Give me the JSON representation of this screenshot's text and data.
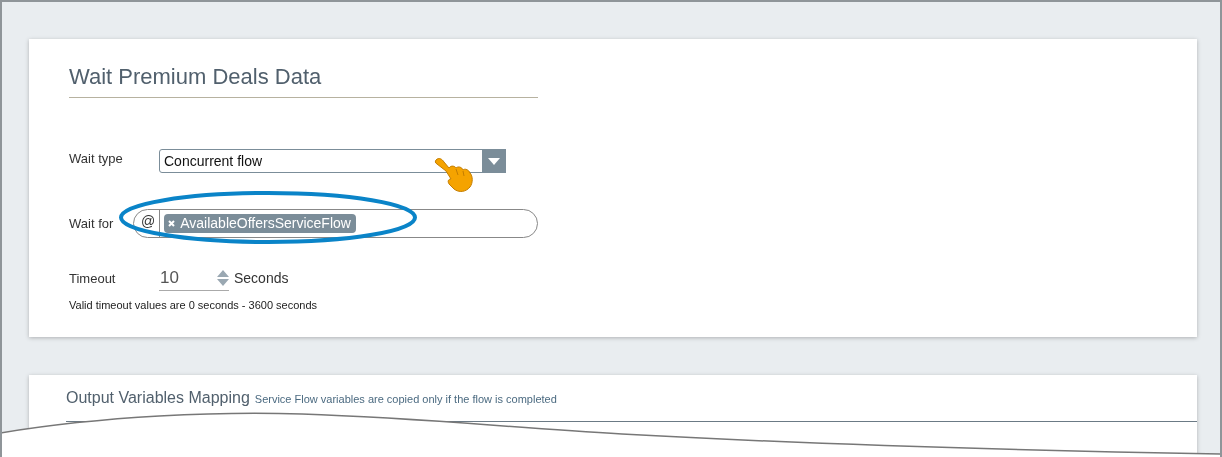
{
  "wait_card": {
    "title": "Wait Premium Deals Data",
    "wait_type": {
      "label": "Wait type",
      "value": "Concurrent flow"
    },
    "wait_for": {
      "label": "Wait for",
      "prefix": "@",
      "tokens": [
        {
          "text": "AvailableOffersServiceFlow"
        }
      ]
    },
    "timeout": {
      "label": "Timeout",
      "value": "10",
      "unit": "Seconds",
      "hint": "Valid timeout values are 0 seconds - 3600 seconds"
    }
  },
  "output_card": {
    "title": "Output Variables Mapping",
    "note": "Service Flow variables are copied only if the flow is completed"
  }
}
